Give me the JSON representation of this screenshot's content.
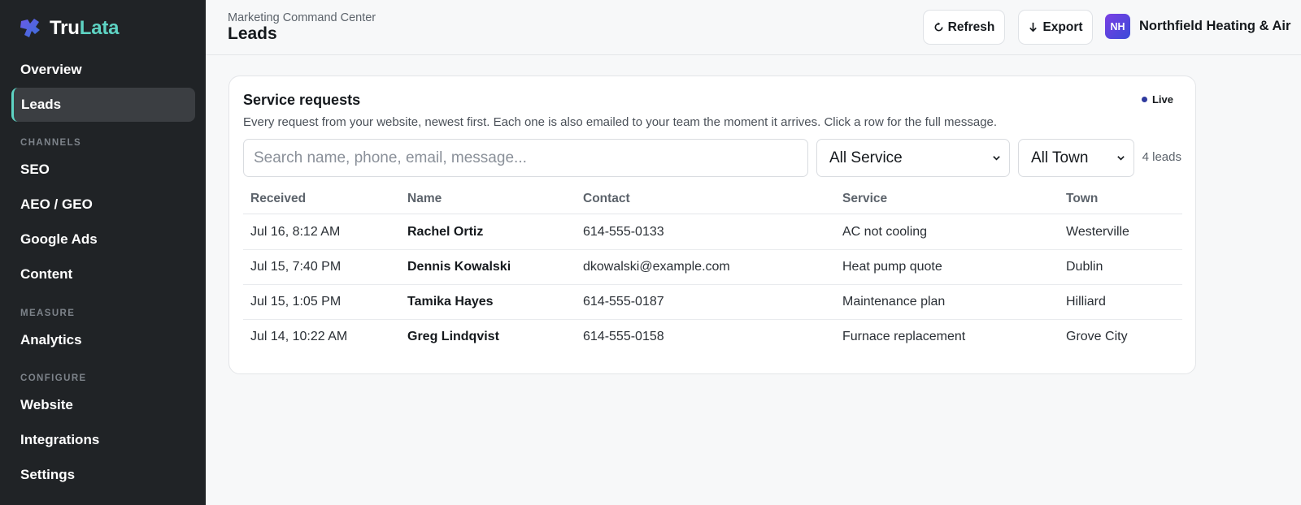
{
  "brand": {
    "part1": "Tru",
    "part2": "Lata"
  },
  "sidebar": {
    "items": [
      {
        "label": "Overview"
      },
      {
        "label": "Leads"
      },
      {
        "label": "SEO"
      },
      {
        "label": "AEO / GEO"
      },
      {
        "label": "Google Ads"
      },
      {
        "label": "Content"
      },
      {
        "label": "Analytics"
      },
      {
        "label": "Website"
      },
      {
        "label": "Integrations"
      },
      {
        "label": "Settings"
      }
    ],
    "sections": {
      "channels": "CHANNELS",
      "measure": "MEASURE",
      "configure": "CONFIGURE"
    },
    "active": "Leads"
  },
  "header": {
    "breadcrumb": "Marketing Command Center",
    "title": "Leads",
    "refresh_label": "Refresh",
    "export_label": "Export",
    "org_initials": "NH",
    "org_name": "Northfield Heating & Air"
  },
  "card": {
    "title": "Service requests",
    "description": "Every request from your website, newest first. Each one is also emailed to your team the moment it arrives. Click a row for the full message.",
    "live_label": "Live",
    "search_placeholder": "Search name, phone, email, message...",
    "service_filter": "All Service",
    "town_filter": "All Town",
    "count": "4 leads"
  },
  "table": {
    "headers": {
      "received": "Received",
      "name": "Name",
      "contact": "Contact",
      "service": "Service",
      "town": "Town"
    },
    "rows": [
      {
        "received": "Jul 16, 8:12 AM",
        "name": "Rachel Ortiz",
        "contact": "614-555-0133",
        "service": "AC not cooling",
        "town": "Westerville"
      },
      {
        "received": "Jul 15, 7:40 PM",
        "name": "Dennis Kowalski",
        "contact": "dkowalski@example.com",
        "service": "Heat pump quote",
        "town": "Dublin"
      },
      {
        "received": "Jul 15, 1:05 PM",
        "name": "Tamika Hayes",
        "contact": "614-555-0187",
        "service": "Maintenance plan",
        "town": "Hilliard"
      },
      {
        "received": "Jul 14, 10:22 AM",
        "name": "Greg Lindqvist",
        "contact": "614-555-0158",
        "service": "Furnace replacement",
        "town": "Grove City"
      }
    ]
  },
  "colors": {
    "sidebar_bg": "#202326",
    "accent": "#5ed3c3",
    "live_dot": "#2f3a9e",
    "avatar_gradient": [
      "#7b3fe4",
      "#3a4bd8"
    ]
  },
  "icons": [
    "brand-logo-icon",
    "refresh-icon",
    "arrow-down-icon",
    "chevron-down-icon"
  ]
}
